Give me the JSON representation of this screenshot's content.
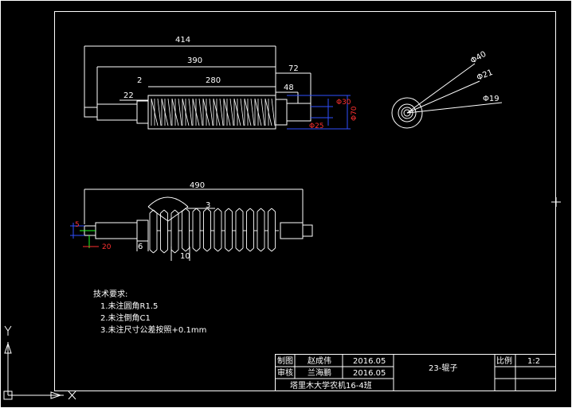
{
  "colors": {
    "background": "#000000",
    "lines": "#ffffff",
    "dims": "#ff3030",
    "dims2": "#3050ff",
    "green": "#20ff20"
  },
  "top_view": {
    "dims": {
      "d414": "414",
      "d390": "390",
      "d72": "72",
      "d2": "2",
      "d280": "280",
      "d48": "48",
      "d22": "22"
    },
    "diameters": {
      "phi30": "Φ30",
      "phi25": "Φ25",
      "phi70": "Φ70"
    }
  },
  "end_view": {
    "phi40": "Φ40",
    "phi21": "Φ21",
    "phi19": "Φ19"
  },
  "front_view": {
    "d490": "490",
    "d3": "3",
    "d6": "6",
    "d10": "10",
    "d20": "20",
    "d5": "5"
  },
  "notes": {
    "title": "技术要求:",
    "items": [
      "1.未注圆角R1.5",
      "2.未注倒角C1",
      "3.未注尺寸公差按照+0.1mm"
    ]
  },
  "title_block": {
    "drawn_label": "制图",
    "drawn_name": "赵成伟",
    "drawn_date": "2016.05",
    "review_label": "审核",
    "review_name": "兰海鹏",
    "review_date": "2016.05",
    "part_name": "23-辊子",
    "scale_label": "比例",
    "scale_value": "1:2",
    "school": "塔里木大学农机16-4班"
  },
  "ucs": {
    "x": "X",
    "y": "Y"
  }
}
